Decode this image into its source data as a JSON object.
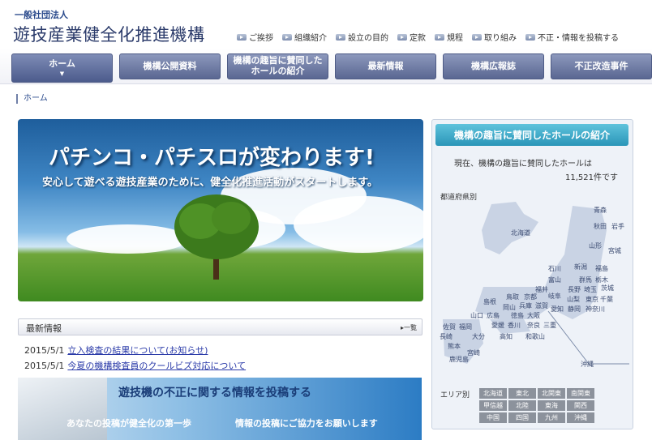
{
  "header": {
    "org_type": "一般社団法人",
    "org_name": "遊技産業健全化推進機構"
  },
  "top_nav": [
    {
      "label": "ご挨拶"
    },
    {
      "label": "組織紹介"
    },
    {
      "label": "設立の目的"
    },
    {
      "label": "定款"
    },
    {
      "label": "規程"
    },
    {
      "label": "取り組み"
    },
    {
      "label": "不正・情報を投稿する"
    }
  ],
  "main_nav": [
    {
      "label": "ホーム",
      "active": true
    },
    {
      "label": "機構公開資料"
    },
    {
      "label": "機構の趣旨に賛同した\nホールの紹介"
    },
    {
      "label": "最新情報"
    },
    {
      "label": "機構広報誌"
    },
    {
      "label": "不正改造事件"
    }
  ],
  "breadcrumb": "ホーム",
  "hero": {
    "title": "パチンコ・パチスロが変わります!",
    "subtitle": "安心して遊べる遊技産業のために、健全化推進活動がスタートします。"
  },
  "news": {
    "heading": "最新情報",
    "more_label": "一覧",
    "items": [
      {
        "date": "2015/5/1",
        "title": "立入検査の結果について(お知らせ)"
      },
      {
        "date": "2015/5/1",
        "title": "今夏の機構検査員のクールビズ対応について"
      }
    ]
  },
  "banner": {
    "title": "遊技機の不正に関する情報を投稿する",
    "sub_left": "あなたの投稿が健全化の第一歩",
    "sub_right": "情報の投稿にご協力をお願いします"
  },
  "side": {
    "title": "機構の趣旨に賛同したホールの紹介",
    "count_line1": "現在、機構の趣旨に賛同したホールは",
    "count_line2": "11,521件です",
    "prefecture_label": "都道府県別",
    "prefectures": [
      "北海道",
      "青森",
      "秋田",
      "岩手",
      "山形",
      "宮城",
      "石川",
      "新潟",
      "福島",
      "富山",
      "群馬",
      "栃木",
      "福井",
      "長野",
      "埼玉",
      "茨城",
      "鳥取",
      "京都",
      "岐阜",
      "山梨",
      "東京",
      "島根",
      "岡山",
      "兵庫",
      "滋賀",
      "愛知",
      "静岡",
      "千葉",
      "山口",
      "広島",
      "大阪",
      "奈良",
      "三重",
      "神奈川",
      "佐賀",
      "福岡",
      "愛媛",
      "香川",
      "長崎",
      "大分",
      "高知",
      "和歌山",
      "徳島",
      "熊本",
      "宮崎",
      "鹿児島",
      "沖縄"
    ],
    "area_label": "エリア別",
    "areas": [
      "北海道",
      "東北",
      "北関東",
      "南関東",
      "甲信越",
      "北陸",
      "東海",
      "関西",
      "中国",
      "四国",
      "九州",
      "沖縄"
    ]
  }
}
